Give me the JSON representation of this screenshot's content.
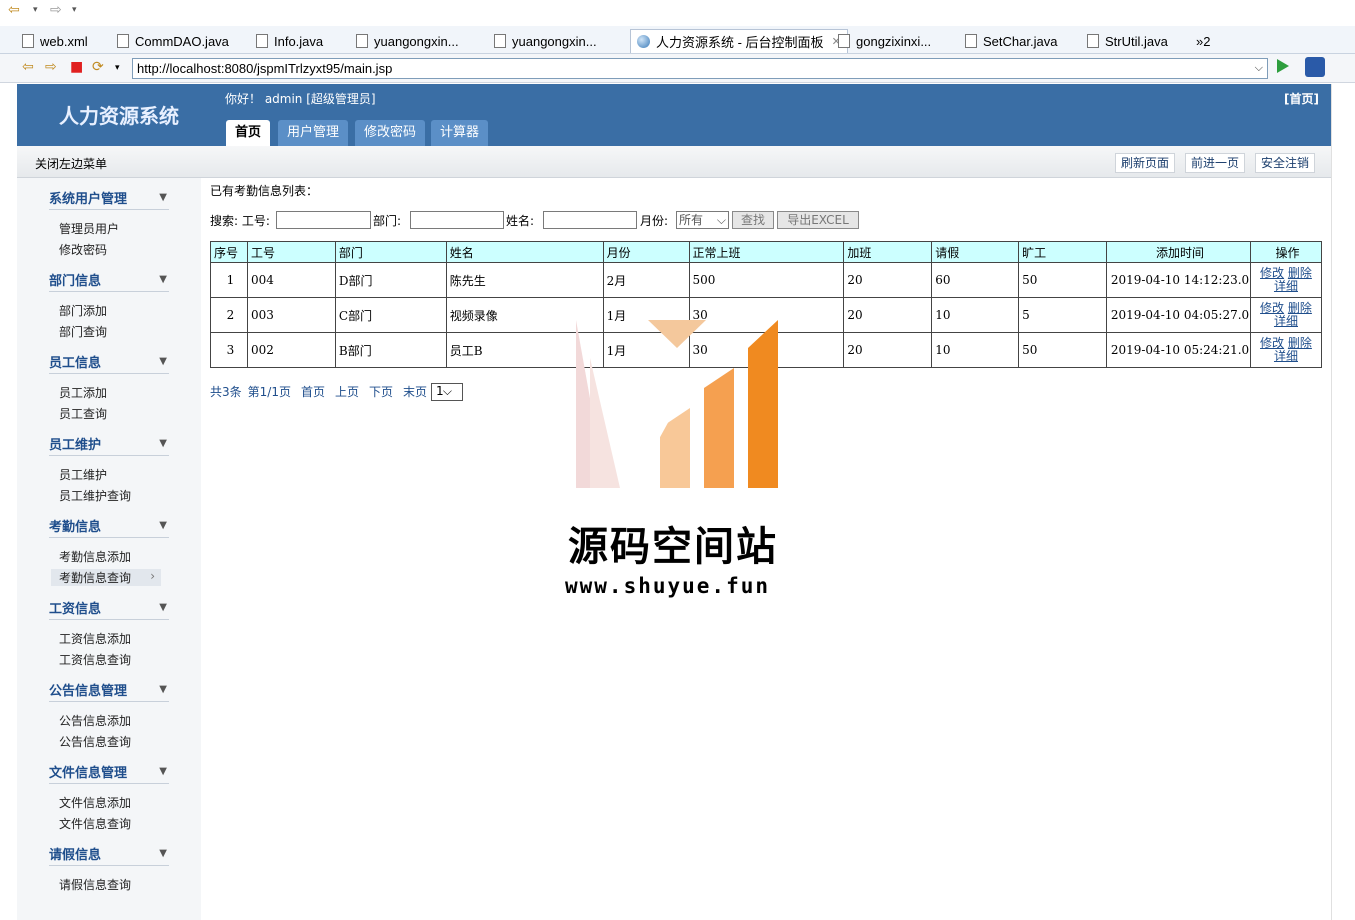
{
  "editor_tabs": [
    {
      "label": "web.xml"
    },
    {
      "label": "CommDAO.java"
    },
    {
      "label": "Info.java"
    },
    {
      "label": "yuangongxin..."
    },
    {
      "label": "yuangongxin..."
    },
    {
      "label": "人力资源系统 - 后台控制面板",
      "active": true
    },
    {
      "label": "gongzixinxi..."
    },
    {
      "label": "SetChar.java"
    },
    {
      "label": "StrUtil.java"
    },
    {
      "label": "»2"
    }
  ],
  "address": {
    "url": "http://localhost:8080/jspmITrlzyxt95/main.jsp"
  },
  "header": {
    "logo": "人力资源系统",
    "greeting": "你好！ admin [超级管理员]",
    "home_link": "[首页]",
    "tabs": [
      "首页",
      "用户管理",
      "修改密码",
      "计算器"
    ]
  },
  "subbar": {
    "close_menu": "关闭左边菜单",
    "refresh": "刷新页面",
    "forward": "前进一页",
    "logout": "安全注销"
  },
  "sidebar": [
    {
      "group": "系统用户管理",
      "items": [
        "管理员用户",
        "修改密码"
      ]
    },
    {
      "group": "部门信息",
      "items": [
        "部门添加",
        "部门查询"
      ]
    },
    {
      "group": "员工信息",
      "items": [
        "员工添加",
        "员工查询"
      ]
    },
    {
      "group": "员工维护",
      "items": [
        "员工维护",
        "员工维护查询"
      ]
    },
    {
      "group": "考勤信息",
      "items": [
        "考勤信息添加",
        "考勤信息查询"
      ]
    },
    {
      "group": "工资信息",
      "items": [
        "工资信息添加",
        "工资信息查询"
      ]
    },
    {
      "group": "公告信息管理",
      "items": [
        "公告信息添加",
        "公告信息查询"
      ]
    },
    {
      "group": "文件信息管理",
      "items": [
        "文件信息添加",
        "文件信息查询"
      ]
    },
    {
      "group": "请假信息",
      "items": [
        "请假信息查询"
      ]
    }
  ],
  "main": {
    "title": "已有考勤信息列表：",
    "search": {
      "label_id": "搜索: 工号:",
      "label_dept": "部门:",
      "label_name": "姓名:",
      "label_month": "月份:",
      "month_value": "所有",
      "search_btn": "查找",
      "export_btn": "导出EXCEL"
    },
    "columns": [
      "序号",
      "工号",
      "部门",
      "姓名",
      "月份",
      "正常上班",
      "加班",
      "请假",
      "旷工",
      "添加时间",
      "操作"
    ],
    "rows": [
      [
        "1",
        "004",
        "D部门",
        "陈先生",
        "2月",
        "500",
        "20",
        "60",
        "50",
        "2019-04-10 14:12:23.0"
      ],
      [
        "2",
        "003",
        "C部门",
        "视频录像",
        "1月",
        "30",
        "20",
        "10",
        "5",
        "2019-04-10 04:05:27.0"
      ],
      [
        "3",
        "002",
        "B部门",
        "员工B",
        "1月",
        "30",
        "20",
        "10",
        "50",
        "2019-04-10 05:24:21.0"
      ]
    ],
    "actions": {
      "edit": "修改",
      "delete": "删除",
      "detail": "详细"
    },
    "pagination": {
      "total": "共3条",
      "page": "第1/1页",
      "first": "首页",
      "prev": "上页",
      "next": "下页",
      "last": "末页",
      "select": "1"
    }
  },
  "watermark": {
    "title": "源码空间站",
    "url": "www.shuyue.fun"
  }
}
